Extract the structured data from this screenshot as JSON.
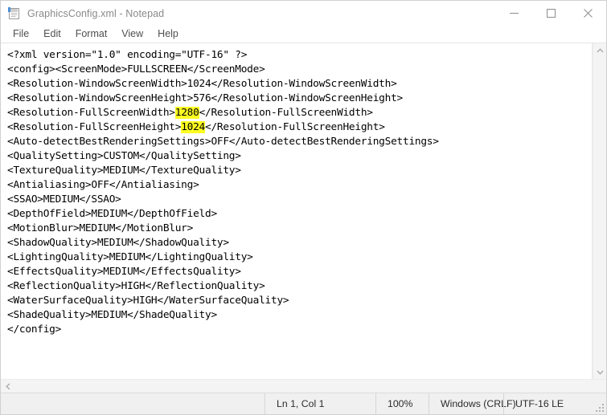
{
  "window": {
    "title": "GraphicsConfig.xml - Notepad",
    "icon": "notepad-icon",
    "controls": {
      "minimize": "minimize-button",
      "maximize": "maximize-button",
      "close": "close-button"
    }
  },
  "menu": {
    "items": [
      {
        "label": "File"
      },
      {
        "label": "Edit"
      },
      {
        "label": "Format"
      },
      {
        "label": "View"
      },
      {
        "label": "Help"
      }
    ]
  },
  "editor": {
    "highlight_color": "#fdfd22",
    "lines": [
      {
        "text": "<?xml version=\"1.0\" encoding=\"UTF-16\" ?>"
      },
      {
        "text": "<config><ScreenMode>FULLSCREEN</ScreenMode>"
      },
      {
        "text": "<Resolution-WindowScreenWidth>1024</Resolution-WindowScreenWidth>"
      },
      {
        "text": "<Resolution-WindowScreenHeight>576</Resolution-WindowScreenHeight>"
      },
      {
        "prefix": "<Resolution-FullScreenWidth>",
        "highlight": "1280",
        "suffix": "</Resolution-FullScreenWidth>"
      },
      {
        "prefix": "<Resolution-FullScreenHeight>",
        "highlight": "1024",
        "suffix": "</Resolution-FullScreenHeight>"
      },
      {
        "text": "<Auto-detectBestRenderingSettings>OFF</Auto-detectBestRenderingSettings>"
      },
      {
        "text": "<QualitySetting>CUSTOM</QualitySetting>"
      },
      {
        "text": "<TextureQuality>MEDIUM</TextureQuality>"
      },
      {
        "text": "<Antialiasing>OFF</Antialiasing>"
      },
      {
        "text": "<SSAO>MEDIUM</SSAO>"
      },
      {
        "text": "<DepthOfField>MEDIUM</DepthOfField>"
      },
      {
        "text": "<MotionBlur>MEDIUM</MotionBlur>"
      },
      {
        "text": "<ShadowQuality>MEDIUM</ShadowQuality>"
      },
      {
        "text": "<LightingQuality>MEDIUM</LightingQuality>"
      },
      {
        "text": "<EffectsQuality>MEDIUM</EffectsQuality>"
      },
      {
        "text": "<ReflectionQuality>HIGH</ReflectionQuality>"
      },
      {
        "text": "<WaterSurfaceQuality>HIGH</WaterSurfaceQuality>"
      },
      {
        "text": "<ShadeQuality>MEDIUM</ShadeQuality>"
      },
      {
        "text": "</config>"
      }
    ]
  },
  "scrollbars": {
    "vertical": {
      "up": "scroll-up-icon",
      "down": "scroll-down-icon"
    },
    "horizontal": {
      "left": "scroll-left-icon"
    }
  },
  "statusbar": {
    "cursor_position": "Ln 1, Col 1",
    "zoom": "100%",
    "line_ending": "Windows (CRLF)",
    "encoding": "UTF-16 LE"
  }
}
